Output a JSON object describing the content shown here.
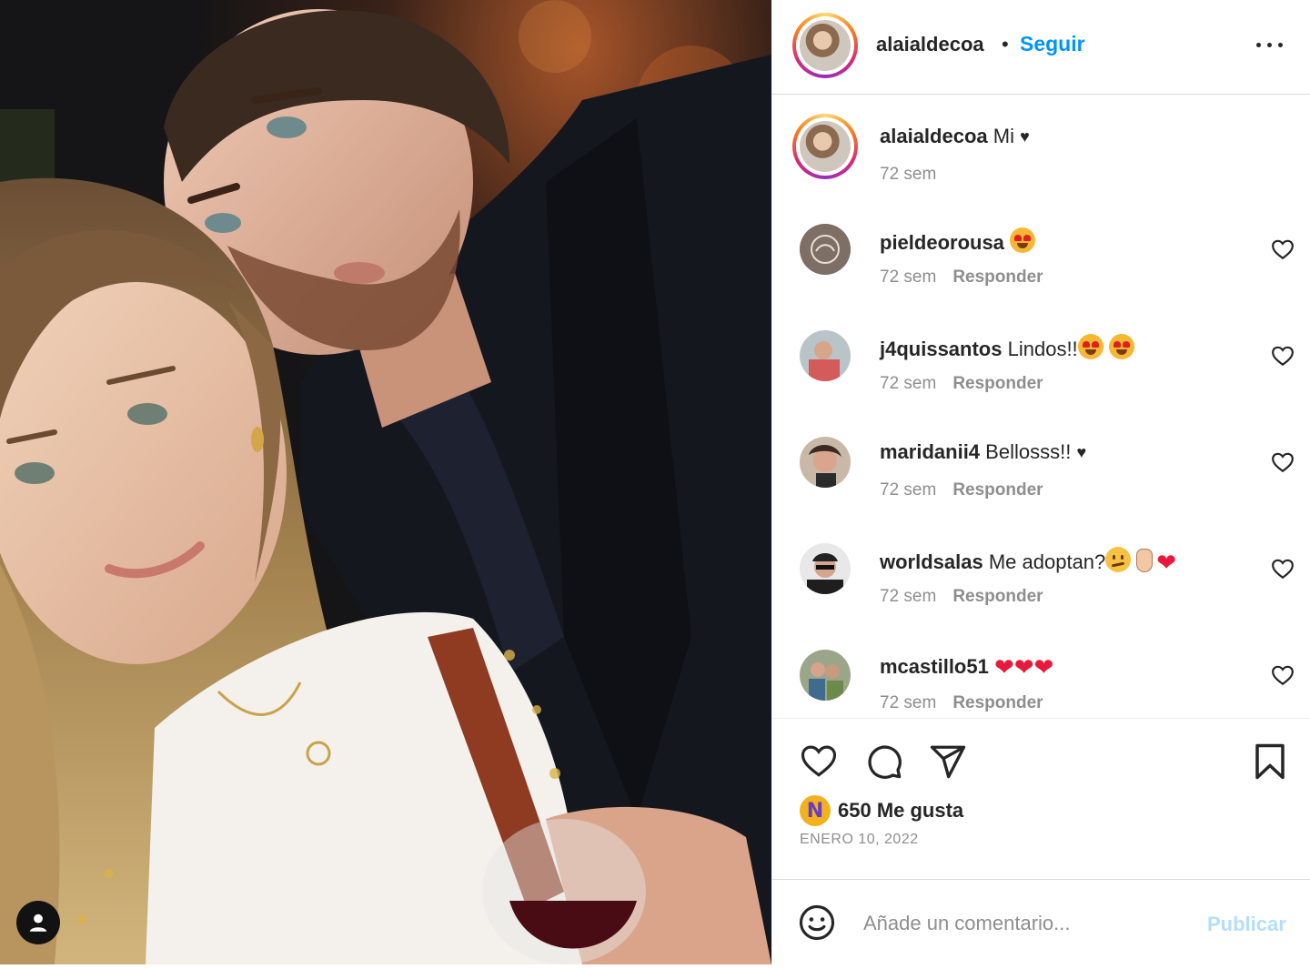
{
  "post": {
    "author": "alaialdecoa",
    "follow_label": "Seguir",
    "separator": "•"
  },
  "caption": {
    "username": "alaialdecoa",
    "text": "Mi",
    "heart": "♥",
    "time": "72 sem"
  },
  "comments": [
    {
      "username": "pieldeorousa",
      "text": "",
      "emojis": [
        "heart-eyes"
      ],
      "time": "72 sem",
      "reply": "Responder"
    },
    {
      "username": "j4quissantos",
      "text": "Lindos!!",
      "emojis": [
        "heart-eyes",
        "heart-eyes"
      ],
      "time": "72 sem",
      "reply": "Responder"
    },
    {
      "username": "maridanii4",
      "text": "Bellosss!!",
      "suffix": "♥",
      "time": "72 sem",
      "reply": "Responder"
    },
    {
      "username": "worldsalas",
      "text": "Me adoptan?",
      "emojis": [
        "confused",
        "hand",
        "heart"
      ],
      "time": "72 sem",
      "reply": "Responder"
    },
    {
      "username": "mcastillo51",
      "text": "",
      "suffix": "❤❤❤",
      "time": "72 sem",
      "reply": "Responder"
    }
  ],
  "stats": {
    "badge_letter": "N",
    "likes": "650 Me gusta",
    "date": "ENERO 10, 2022"
  },
  "composer": {
    "placeholder": "Añade un comentario...",
    "publish_label": "Publicar"
  },
  "colors": {
    "accent": "#0095f6",
    "publish_disabled": "#b2dffc",
    "muted": "#8e8e8e",
    "text": "#262626"
  },
  "icons": [
    "more-options-icon",
    "like-heart-icon",
    "comment-icon",
    "share-icon",
    "bookmark-icon",
    "emoji-icon",
    "user-tag-icon"
  ]
}
